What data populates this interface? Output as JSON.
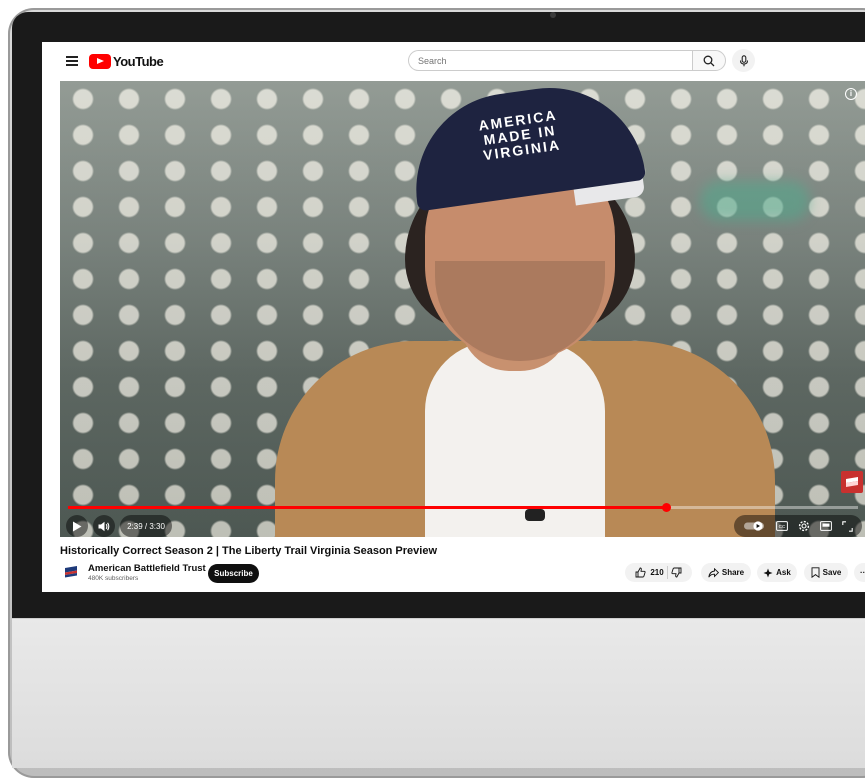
{
  "app": {
    "name": "YouTube"
  },
  "search": {
    "placeholder": "Search"
  },
  "video": {
    "cap_text": "AMERICA\nMADE IN\nVIRGINIA",
    "time": "2:39 / 3:30",
    "progress_fraction": 0.757
  },
  "info": {
    "title": "Historically Correct Season 2 | The Liberty Trail Virginia Season Preview",
    "channel_name": "American Battlefield Trust",
    "subscribers": "480K subscribers",
    "subscribe_label": "Subscribe"
  },
  "actions": {
    "likes": "210",
    "share": "Share",
    "ask": "Ask",
    "save": "Save",
    "more": "···"
  },
  "colors": {
    "accent": "#ff0000",
    "sweater": "#b88956",
    "cap": "#1e2340"
  }
}
